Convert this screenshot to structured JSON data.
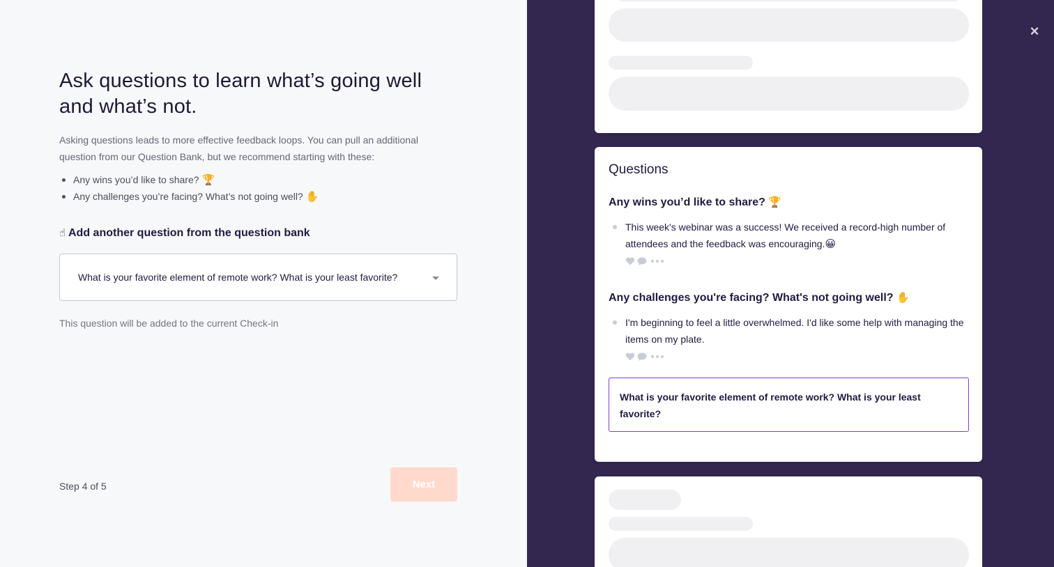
{
  "left": {
    "title": "Ask questions to learn what’s going well and what’s not.",
    "intro": "Asking questions leads to more effective feedback loops. You can pull an additional question from our Question Bank, but we recommend starting with these:",
    "bullets": [
      {
        "text": "Any wins you’d like to share?",
        "emoji": "🏆"
      },
      {
        "text": "Any challenges you’re facing? What’s not going well?",
        "emoji": "✋"
      }
    ],
    "bank_heading": {
      "emoji": "☝",
      "text": "Add another question from the question bank"
    },
    "select": {
      "value": "What is your favorite element of remote work? What is your least favorite?"
    },
    "helper": "This question will be added to the current Check-in",
    "step": "Step 4 of 5",
    "next_label": "Next"
  },
  "right": {
    "close_icon": "×",
    "questions_title": "Questions",
    "questions": [
      {
        "heading": "Any wins you’d like to share?",
        "emoji": "🏆",
        "answer": "This week's webinar was a success! We received a record-high number of attendees and the feedback was encouraging.",
        "answer_emoji": "😀"
      },
      {
        "heading": "Any challenges you're facing? What's not going well?",
        "emoji": "✋",
        "answer": "I'm beginning to feel a little overwhelmed. I'd like some help with managing the items on my plate.",
        "answer_emoji": ""
      }
    ],
    "new_question": "What is your favorite element of remote work? What is your least favorite?"
  },
  "colors": {
    "panel_bg": "#33264f",
    "accent_border": "#7b3fcf",
    "next_button_disabled": "#ffd9cc",
    "skeleton": "#f0f0f2"
  }
}
